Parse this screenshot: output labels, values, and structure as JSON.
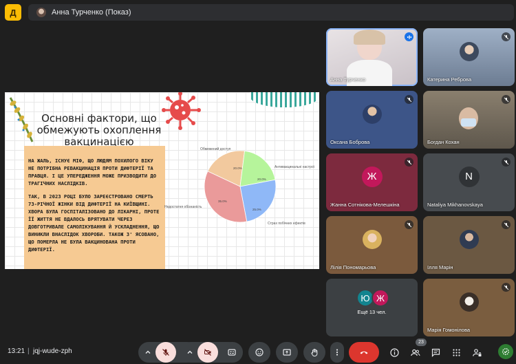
{
  "top_bar": {
    "app_badge": "Д",
    "presenter": "Анна Турченко (Показ)"
  },
  "slide": {
    "title": "Основні фактори, що обмежують охоплення вакцинацією",
    "paragraphs": [
      "НА ЖАЛЬ, ІСНУЄ МІФ, ЩО ЛЮДЯМ ПОХИЛОГО ВІКУ НЕ ПОТРІБНА РЕВАКЦИНАЦІЯ ПРОТИ ДИФТЕРІЇ ТА ПРАВЦЯ. І ЦЕ УПЕРЕДЖЕННЯ МОЖЕ ПРИЗВОДИТИ ДО ТРАГІЧНИХ НАСЛІДКІВ.",
      "ТАК, В 2023 РОЦІ БУЛО ЗАРЕЄСТРОВАНО СМЕРТЬ 73-РІЧНОЇ ЖІНКИ ВІД ДИФТЕРІЇ НА КИЇВЩИНІ. ХВОРА БУЛА ГОСПІТАЛІЗОВАНО ДО ЛІКАРНІ, ПРОТЕ ЇЇ ЖИТТЯ НЕ ВДАЛОСЬ ВРЯТУВАТИ ЧЕРЕЗ ДОВГОТРИВАЛЕ САМОЛІКУВАННЯ Й УСКЛАДНЕННЯ, ЩО ВИНИКЛИ ВНАСЛІДОК ХВОРОБИ. ТАКОЖ З' ЯСОВАНО, ЩО ПОМЕРЛА НЕ БУЛА ВАКЦИНОВАНА ПРОТИ ДИФТЕРІЇ."
    ],
    "chart_data": {
      "type": "pie",
      "series": [
        {
          "name": "Обмежений доступ",
          "value": 20.0,
          "label": "20.0%",
          "color": "#f2c99e"
        },
        {
          "name": "Антивакцинальні настрої",
          "value": 20.0,
          "label": "20.0%",
          "color": "#b6f49b"
        },
        {
          "name": "Страх побічних ефектів",
          "value": 25.0,
          "label": "25.0%",
          "color": "#8fb8f7"
        },
        {
          "name": "Недостатня обізнаність",
          "value": 35.0,
          "label": "35.0%",
          "color": "#ea9a9a"
        }
      ]
    }
  },
  "participants": [
    {
      "name": "Анна Турченко",
      "kind": "video",
      "speaking": true,
      "mic": "active"
    },
    {
      "name": "Катерина Реброва",
      "kind": "video",
      "mic": "muted"
    },
    {
      "name": "Оксана Боброва",
      "kind": "photo",
      "mic": "muted",
      "bg": "#3d5588"
    },
    {
      "name": "Богдан Кохан",
      "kind": "video",
      "mic": "muted"
    },
    {
      "name": "Жанна Сотнікова-Мелешкіна",
      "kind": "letter",
      "letter": "Ж",
      "bg": "#7d2a3e",
      "avatar_color": "#c2185b",
      "mic": "muted"
    },
    {
      "name": "Nataliya Mikhanovskaya",
      "kind": "letter",
      "letter": "N",
      "bg": "#474b4f",
      "avatar_color": "#3c4043",
      "mic": "muted"
    },
    {
      "name": "Лілія Пономарьова",
      "kind": "photo",
      "mic": "muted",
      "bg": "#7b5a3d"
    },
    {
      "name": "Ілля Марін",
      "kind": "photo",
      "mic": "muted",
      "bg": "#6b5842"
    },
    {
      "name": "Ещё 13 чел.",
      "kind": "more",
      "letters": [
        "Ю",
        "Ж"
      ]
    },
    {
      "name": "Марія Гомонілова",
      "kind": "photo",
      "mic": "muted",
      "bg": "#7a5d3f"
    }
  ],
  "bottom_bar": {
    "time": "13:21",
    "separator": "|",
    "meeting_code": "jqj-wude-zph",
    "participants_count": "23"
  },
  "colors": {
    "background": "#1f1f1f",
    "tile": "#3c4043",
    "accent_blue": "#8ab4f8",
    "hangup_red": "#dc362e",
    "muted_pink": "#f9dedc"
  }
}
